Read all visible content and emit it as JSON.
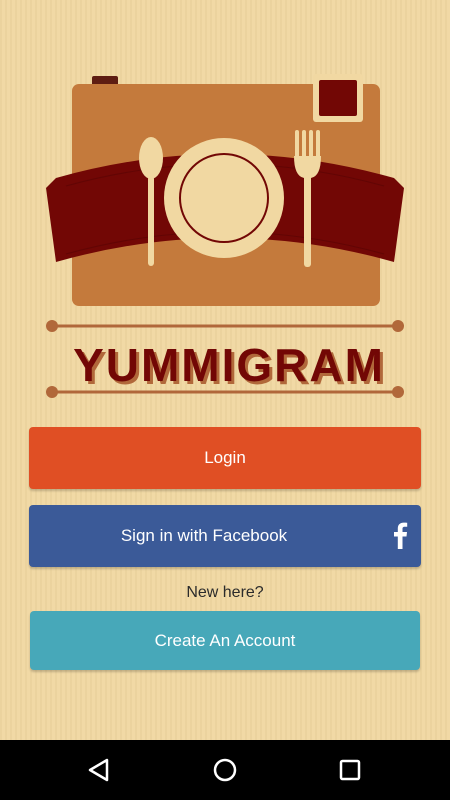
{
  "app": {
    "brand": "YUMMIGRAM"
  },
  "auth": {
    "login_label": "Login",
    "facebook_label": "Sign in with Facebook",
    "new_here": "New here?",
    "create_label": "Create An Account"
  },
  "icons": {
    "facebook": "facebook-f-icon",
    "back": "back-triangle-icon",
    "home": "home-circle-icon",
    "recents": "recents-square-icon"
  },
  "colors": {
    "background": "#f1d8a2",
    "login": "#e04f24",
    "facebook": "#3b5a98",
    "create": "#47a8b9",
    "camera": "#c47a3c",
    "ribbon": "#720705",
    "navbar": "#000000"
  }
}
